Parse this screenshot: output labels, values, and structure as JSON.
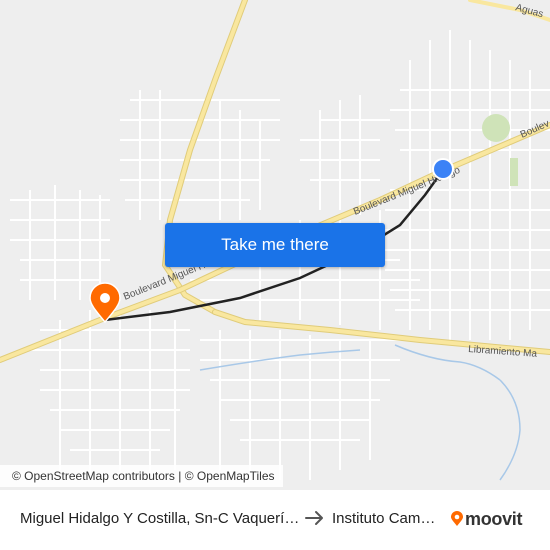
{
  "map": {
    "road_labels": {
      "boulevard_1": "Boulevard Miguel Hidalgo",
      "boulevard_2": "Boulevard Miguel Hidalgo",
      "boulevard_edge": "Boulev",
      "libramiento": "Libramiento Ma",
      "top_right": "Aguas"
    },
    "colors": {
      "route": "#222222",
      "origin_pin": "#ff6a00",
      "destination_dot": "#3b82f6",
      "major_road": "#f9e79f",
      "button": "#1a73e8"
    }
  },
  "cta": {
    "label": "Take me there"
  },
  "attribution": {
    "osm": "© OpenStreetMap contributors",
    "separator": "|",
    "omt": "© OpenMapTiles"
  },
  "footer": {
    "from": "Miguel Hidalgo Y Costilla, Sn-C Vaquerías",
    "to": "Instituto Cambridge",
    "brand": "moovit"
  }
}
